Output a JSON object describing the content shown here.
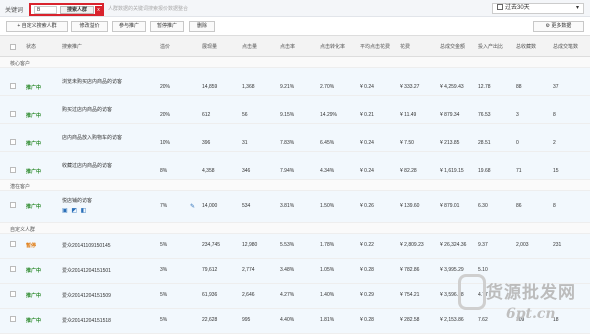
{
  "topbar": {
    "label": "关键词",
    "keyword_value": "B",
    "search_button": "搜索人群",
    "clear_badge": "x",
    "hint": "人群数据的关键词搜索报价数据整合",
    "period": "过去30天"
  },
  "toolbar": {
    "add_custom": "+ 自定义搜索人群",
    "edit_bid": "修改溢价",
    "join_promo": "参与推广",
    "pause_promo": "暂停推广",
    "delete": "删除",
    "more_data": "更多数据"
  },
  "columns": [
    "状态",
    "搜索推广",
    "溢价",
    "展现量",
    "点击量",
    "点击率",
    "点击转化率",
    "平均点击花费",
    "花费",
    "总成交金额",
    "投入产出比",
    "总收藏数",
    "总成交笔数"
  ],
  "groups": {
    "core": "核心客户",
    "potential": "潜在客户",
    "custom": "自定义人群"
  },
  "core_rows": [
    {
      "status": "推广中",
      "name": "浏览未购买店内商品的访客",
      "premium": "20%",
      "impressions": "14,859",
      "clicks": "1,368",
      "ctr": "9.21%",
      "cvr": "2.70%",
      "cpc": "¥ 0.24",
      "cost": "¥ 333.27",
      "gmv": "¥ 4,259.43",
      "roi": "12.78",
      "fav": "88",
      "orders": "37"
    },
    {
      "status": "推广中",
      "name": "购买过店内商品的访客",
      "premium": "20%",
      "impressions": "612",
      "clicks": "56",
      "ctr": "9.15%",
      "cvr": "14.29%",
      "cpc": "¥ 0.21",
      "cost": "¥ 11.49",
      "gmv": "¥ 879.34",
      "roi": "76.53",
      "fav": "3",
      "orders": "8"
    },
    {
      "status": "推广中",
      "name": "店内商品放入购物车的访客",
      "premium": "10%",
      "impressions": "396",
      "clicks": "31",
      "ctr": "7.83%",
      "cvr": "6.45%",
      "cpc": "¥ 0.24",
      "cost": "¥ 7.50",
      "gmv": "¥ 213.85",
      "roi": "28.51",
      "fav": "0",
      "orders": "2"
    },
    {
      "status": "推广中",
      "name": "收藏过店内商品的访客",
      "premium": "8%",
      "impressions": "4,358",
      "clicks": "346",
      "ctr": "7.94%",
      "cvr": "4.34%",
      "cpc": "¥ 0.24",
      "cost": "¥ 82.28",
      "gmv": "¥ 1,619.15",
      "roi": "19.68",
      "fav": "71",
      "orders": "15"
    }
  ],
  "potential_rows": [
    {
      "status": "推广中",
      "name": "悦店铺的访客",
      "icons": "▣ ◩ ◧",
      "premium": "7%",
      "impressions": "14,000",
      "clicks": "534",
      "ctr": "3.81%",
      "cvr": "1.50%",
      "cpc": "¥ 0.26",
      "cost": "¥ 139.60",
      "gmv": "¥ 879.01",
      "roi": "6.30",
      "fav": "86",
      "orders": "8"
    }
  ],
  "custom_rows": [
    {
      "status": "暂停",
      "name": "爱众20141109150145",
      "premium": "5%",
      "impressions": "234,745",
      "clicks": "12,980",
      "ctr": "5.53%",
      "cvr": "1.78%",
      "cpc": "¥ 0.22",
      "cost": "¥ 2,809.23",
      "gmv": "¥ 26,324.36",
      "roi": "9.37",
      "fav": "2,003",
      "orders": "231"
    },
    {
      "status": "推广中",
      "name": "爱众20141204151501",
      "premium": "3%",
      "impressions": "79,612",
      "clicks": "2,774",
      "ctr": "3.48%",
      "cvr": "1.05%",
      "cpc": "¥ 0.28",
      "cost": "¥ 782.86",
      "gmv": "¥ 3,995.29",
      "roi": "5.10",
      "fav": "",
      "orders": ""
    },
    {
      "status": "推广中",
      "name": "爱众20141204151509",
      "premium": "5%",
      "impressions": "61,936",
      "clicks": "2,646",
      "ctr": "4.27%",
      "cvr": "1.40%",
      "cpc": "¥ 0.29",
      "cost": "¥ 754.21",
      "gmv": "¥ 3,596.98",
      "roi": "4.77",
      "fav": "",
      "orders": ""
    },
    {
      "status": "推广中",
      "name": "爱众20141204151518",
      "premium": "5%",
      "impressions": "22,628",
      "clicks": "995",
      "ctr": "4.40%",
      "cvr": "1.81%",
      "cpc": "¥ 0.28",
      "cost": "¥ 282.58",
      "gmv": "¥ 2,153.86",
      "roi": "7.62",
      "fav": "109",
      "orders": "18"
    }
  ],
  "watermark": {
    "text": "货源批发网",
    "url": "6pt.cn"
  }
}
